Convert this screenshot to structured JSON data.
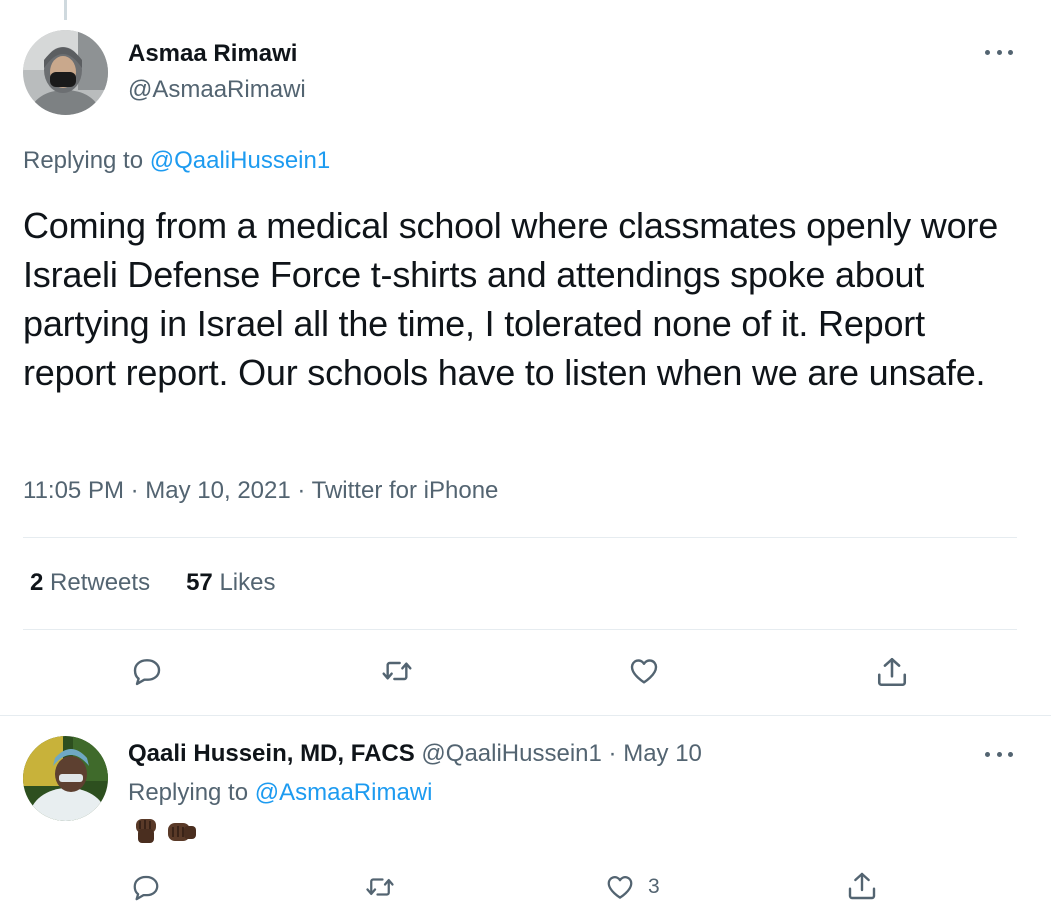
{
  "main_tweet": {
    "author_name": "Asmaa Rimawi",
    "author_handle": "@AsmaaRimawi",
    "replying_prefix": "Replying to",
    "replying_handle": "@QaaliHussein1",
    "text": "Coming from a medical school where classmates openly wore Israeli Defense Force t-shirts and attendings spoke about partying in Israel all the time, I tolerated none of it. Report report report. Our schools have to listen when we are unsafe.",
    "time": "11:05 PM",
    "separator": "·",
    "date": "May 10, 2021",
    "source": "Twitter for iPhone",
    "retweets_count": "2",
    "retweets_label": "Retweets",
    "likes_count": "57",
    "likes_label": "Likes"
  },
  "reply_tweet": {
    "author_name": "Qaali Hussein, MD, FACS",
    "author_handle": "@QaaliHussein1",
    "separator": "·",
    "date": "May 10",
    "replying_prefix": "Replying to",
    "replying_handle": "@AsmaaRimawi",
    "text_emoji": [
      "raised-fist-emoji",
      "oncoming-fist-emoji"
    ],
    "like_count": "3"
  },
  "icons": {
    "reply": "reply-icon",
    "retweet": "retweet-icon",
    "like": "heart-icon",
    "share": "share-icon",
    "more": "more-icon"
  },
  "colors": {
    "link": "#1d9bf0",
    "muted": "#536471",
    "text": "#0f1419",
    "divider": "#e6ecf0"
  }
}
